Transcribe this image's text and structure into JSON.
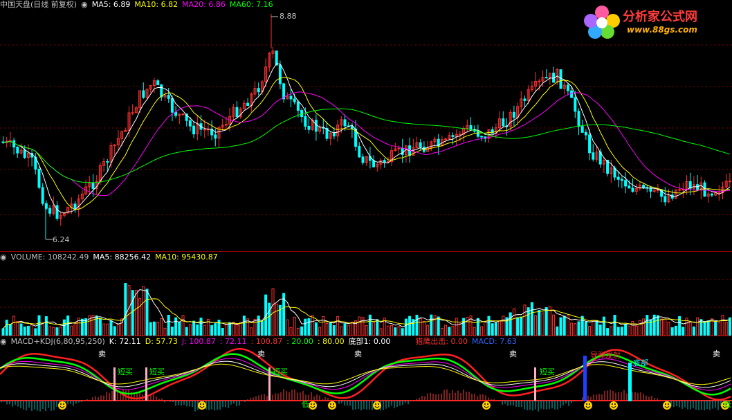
{
  "price_panel": {
    "title": "中国天盘(日线 前复权)",
    "ma": [
      {
        "label": "MA5: 6.89",
        "color": "#ffffff"
      },
      {
        "label": "MA10: 6.82",
        "color": "#ffff00"
      },
      {
        "label": "MA20: 6.86",
        "color": "#ff00ff"
      },
      {
        "label": "MA60: 7.16",
        "color": "#00ff00"
      }
    ],
    "high_label": "8.88",
    "low_label": "6.24"
  },
  "volume_panel": {
    "title": "VOLUME: 108242.49",
    "ma5": "MA5: 88256.42",
    "ma10": "MA10: 95430.87"
  },
  "indicator_panel": {
    "title": "MACD+KDJ(6,80,95,250)",
    "k": "K: 72.11",
    "d": "D: 57.73",
    "j": "J: 100.87",
    "v1": ": 72.11",
    "v2": ": 100.87",
    "v3": ": 20.00",
    "v4": ": 80.00",
    "bottom1": "底部1: 0.00",
    "eagle": "猎鹰出击: 0.00",
    "macd": "MACD: 7.63",
    "tags": {
      "short_buy": "短买",
      "missile": "导弹发射",
      "bottom": "底部",
      "sell": "卖",
      "low": "低"
    }
  },
  "watermark": {
    "title": "分析家公式网",
    "url": "www.88gs.com"
  },
  "colors": {
    "up": "#ff3030",
    "down": "#00ffff",
    "ma5": "#ffffff",
    "ma10": "#ffff00",
    "ma20": "#ff00ff",
    "ma60": "#00ff00",
    "grid": "#8b0000"
  }
}
